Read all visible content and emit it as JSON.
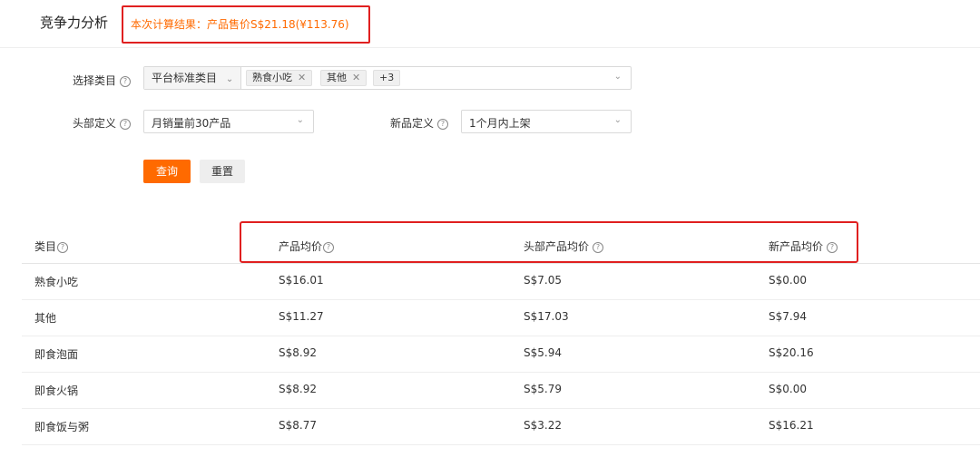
{
  "header": {
    "title": "竞争力分析",
    "result": "本次计算结果：产品售价S$21.18(¥113.76)"
  },
  "filters": {
    "category_label": "选择类目",
    "category_source": "平台标准类目",
    "category_tags": [
      "熟食小吃",
      "其他"
    ],
    "category_more": "+3",
    "head_label": "头部定义",
    "head_value": "月销量前30产品",
    "new_label": "新品定义",
    "new_value": "1个月内上架",
    "query_button": "查询",
    "reset_button": "重置"
  },
  "table": {
    "columns": [
      "类目",
      "产品均价",
      "头部产品均价",
      "新产品均价"
    ],
    "rows": [
      [
        "熟食小吃",
        "S$16.01",
        "S$7.05",
        "S$0.00"
      ],
      [
        "其他",
        "S$11.27",
        "S$17.03",
        "S$7.94"
      ],
      [
        "即食泡面",
        "S$8.92",
        "S$5.94",
        "S$20.16"
      ],
      [
        "即食火锅",
        "S$8.92",
        "S$5.79",
        "S$0.00"
      ],
      [
        "即食饭与粥",
        "S$8.77",
        "S$3.22",
        "S$16.21"
      ]
    ]
  },
  "icons": {
    "help": "question-circle-icon",
    "close": "close-icon",
    "chevron": "chevron-down-icon"
  },
  "colors": {
    "accent": "#ff6a00",
    "highlight": "#e02020"
  }
}
